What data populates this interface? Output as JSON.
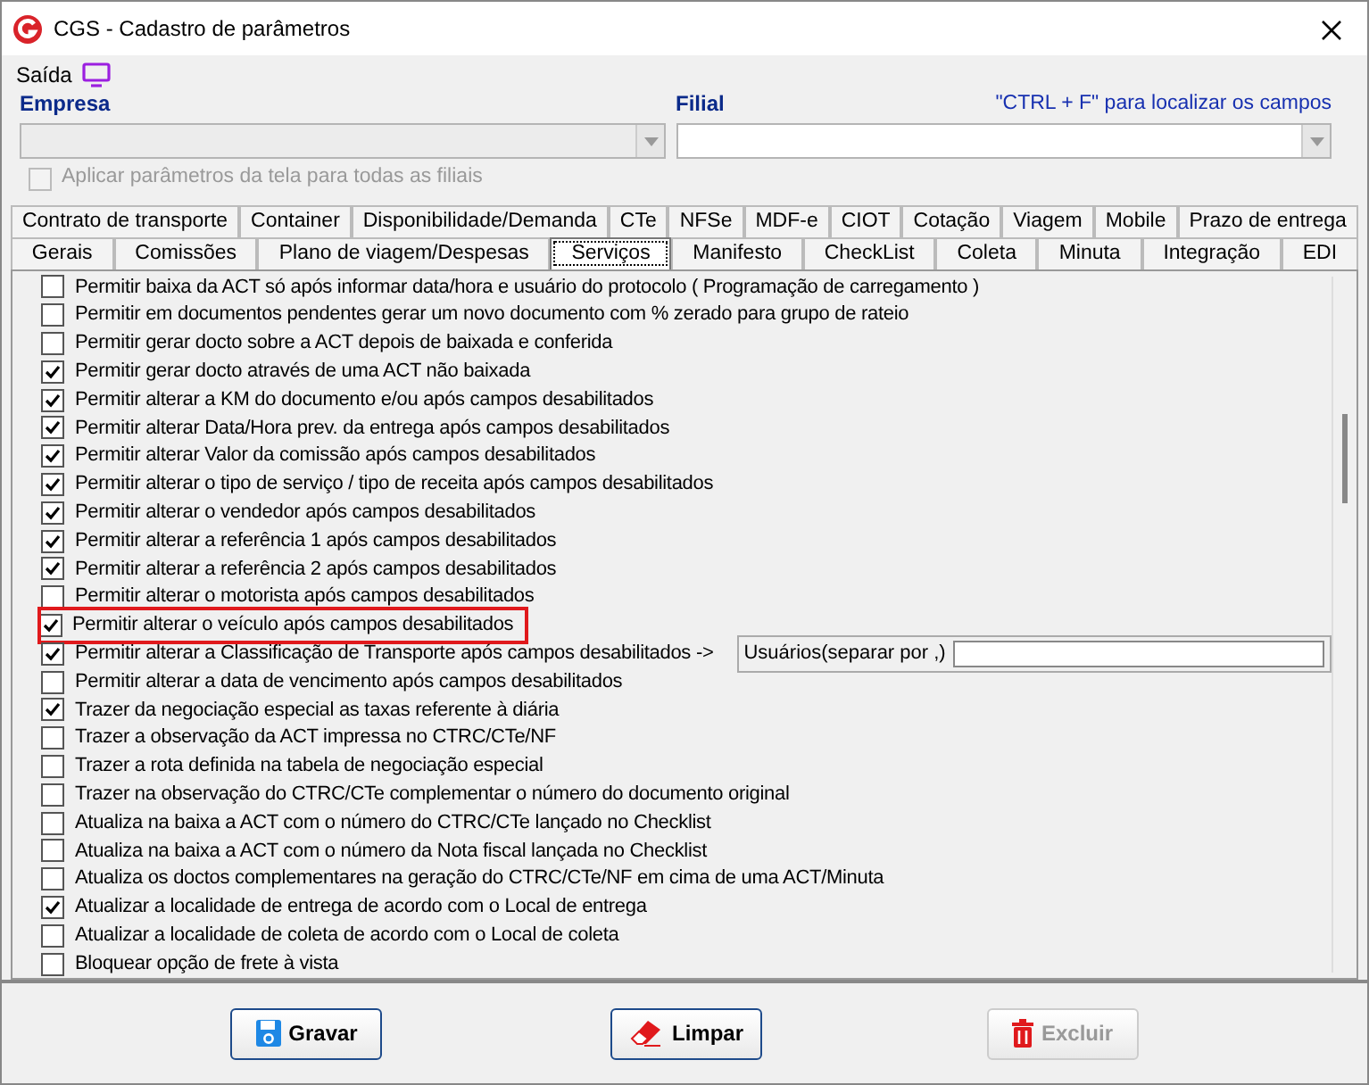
{
  "window": {
    "title": "CGS - Cadastro de parâmetros"
  },
  "menu": [
    {
      "label": "Saída"
    }
  ],
  "header": {
    "empresa_label": "Empresa",
    "filial_label": "Filial",
    "hint": "\"CTRL + F\" para localizar os campos",
    "apply_all": {
      "label": "Aplicar parâmetros da tela para todas as filiais",
      "checked": false,
      "disabled": true
    }
  },
  "tab_rows": [
    [
      {
        "label": "Contrato de transporte",
        "selected": false
      },
      {
        "label": "Container",
        "selected": false
      },
      {
        "label": "Disponibilidade/Demanda",
        "selected": false
      },
      {
        "label": "CTe",
        "selected": false
      },
      {
        "label": "NFSe",
        "selected": false
      },
      {
        "label": "MDF-e",
        "selected": false
      },
      {
        "label": "CIOT",
        "selected": false
      },
      {
        "label": "Cotação",
        "selected": false
      },
      {
        "label": "Viagem",
        "selected": false
      },
      {
        "label": "Mobile",
        "selected": false
      },
      {
        "label": "Prazo de entrega",
        "selected": false
      }
    ],
    [
      {
        "label": "Gerais",
        "selected": false
      },
      {
        "label": "Comissões",
        "selected": false
      },
      {
        "label": "Plano de viagem/Despesas",
        "selected": false
      },
      {
        "label": "Serviços",
        "selected": true
      },
      {
        "label": "Manifesto",
        "selected": false
      },
      {
        "label": "CheckList",
        "selected": false
      },
      {
        "label": "Coleta",
        "selected": false
      },
      {
        "label": "Minuta",
        "selected": false
      },
      {
        "label": "Integração",
        "selected": false
      },
      {
        "label": "EDI",
        "selected": false
      }
    ]
  ],
  "options": [
    {
      "label": "Permitir baixa da ACT só após informar data/hora e usuário do protocolo ( Programação de carregamento )",
      "checked": false,
      "highlighted": false
    },
    {
      "label": "Permitir em documentos pendentes gerar um novo documento com % zerado para grupo de rateio",
      "checked": false,
      "highlighted": false
    },
    {
      "label": "Permitir gerar docto sobre a ACT depois de baixada e conferida",
      "checked": false,
      "highlighted": false
    },
    {
      "label": "Permitir gerar docto através de uma ACT não baixada",
      "checked": true,
      "highlighted": false
    },
    {
      "label": "Permitir alterar a KM do documento e/ou após campos desabilitados",
      "checked": true,
      "highlighted": false
    },
    {
      "label": "Permitir alterar Data/Hora prev. da entrega após campos desabilitados",
      "checked": true,
      "highlighted": false
    },
    {
      "label": "Permitir alterar Valor da comissão após campos desabilitados",
      "checked": true,
      "highlighted": false
    },
    {
      "label": "Permitir alterar o tipo de serviço / tipo de receita após campos desabilitados",
      "checked": true,
      "highlighted": false
    },
    {
      "label": "Permitir alterar o vendedor após campos desabilitados",
      "checked": true,
      "highlighted": false
    },
    {
      "label": "Permitir alterar a referência 1 após campos desabilitados",
      "checked": true,
      "highlighted": false
    },
    {
      "label": "Permitir alterar a referência 2 após campos desabilitados",
      "checked": true,
      "highlighted": false
    },
    {
      "label": "Permitir alterar o motorista após campos desabilitados",
      "checked": false,
      "highlighted": false
    },
    {
      "label": "Permitir alterar o veículo após campos desabilitados",
      "checked": true,
      "highlighted": true
    },
    {
      "label": "Permitir alterar a Classificação de Transporte após campos desabilitados ->",
      "checked": true,
      "highlighted": false,
      "users_label": "Usuários(separar por ,)"
    },
    {
      "label": "Permitir alterar a data de vencimento após campos desabilitados",
      "checked": false,
      "highlighted": false
    },
    {
      "label": "Trazer da negociação especial as taxas referente à diária",
      "checked": true,
      "highlighted": false
    },
    {
      "label": "Trazer a observação da ACT impressa no CTRC/CTe/NF",
      "checked": false,
      "highlighted": false
    },
    {
      "label": "Trazer a rota definida na tabela de negociação especial",
      "checked": false,
      "highlighted": false
    },
    {
      "label": "Trazer na observação do CTRC/CTe complementar o número do documento original",
      "checked": false,
      "highlighted": false
    },
    {
      "label": "Atualiza na baixa a ACT com o número do CTRC/CTe lançado no Checklist",
      "checked": false,
      "highlighted": false
    },
    {
      "label": "Atualiza na baixa a ACT com o número da Nota fiscal lançada no Checklist",
      "checked": false,
      "highlighted": false
    },
    {
      "label": "Atualiza os doctos complementares na geração do CTRC/CTe/NF em cima de uma ACT/Minuta",
      "checked": false,
      "highlighted": false
    },
    {
      "label": "Atualizar a localidade de entrega de acordo com o Local de entrega",
      "checked": true,
      "highlighted": false
    },
    {
      "label": "Atualizar a localidade de coleta de acordo com o Local de coleta",
      "checked": false,
      "highlighted": false
    },
    {
      "label": "Bloquear opção de frete à vista",
      "checked": false,
      "highlighted": false
    }
  ],
  "buttons": [
    {
      "label": "Gravar",
      "kind": "save",
      "disabled": false
    },
    {
      "label": "Limpar",
      "kind": "clear",
      "disabled": false
    },
    {
      "label": "Excluir",
      "kind": "delete",
      "disabled": true
    }
  ]
}
